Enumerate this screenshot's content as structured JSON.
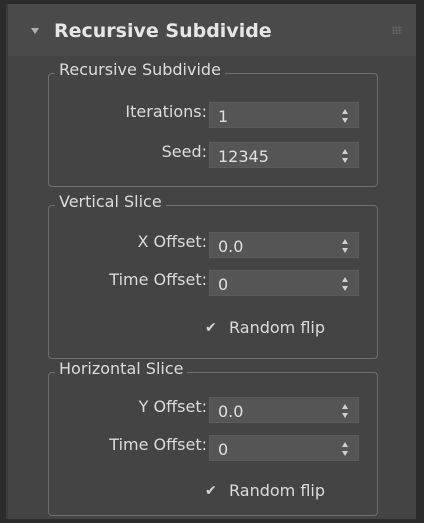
{
  "rollout": {
    "title": "Recursive Subdivide"
  },
  "groups": {
    "recursive": {
      "title": "Recursive Subdivide",
      "iterations_label": "Iterations:",
      "iterations_value": "1",
      "seed_label": "Seed:",
      "seed_value": "12345"
    },
    "vertical": {
      "title": "Vertical Slice",
      "x_offset_label": "X Offset:",
      "x_offset_value": "0.0",
      "time_offset_label": "Time Offset:",
      "time_offset_value": "0",
      "random_flip_label": "Random flip",
      "random_flip_checked": true
    },
    "horizontal": {
      "title": "Horizontal Slice",
      "y_offset_label": "Y Offset:",
      "y_offset_value": "0.0",
      "time_offset_label": "Time Offset:",
      "time_offset_value": "0",
      "random_flip_label": "Random flip",
      "random_flip_checked": true
    }
  },
  "icons": {
    "collapse": "triangle-down",
    "grip": "dots-grip",
    "check": "checkmark"
  },
  "colors": {
    "background": "#2b2b2b",
    "panel": "#444444",
    "field": "#555555",
    "text": "#dcdcdc"
  }
}
